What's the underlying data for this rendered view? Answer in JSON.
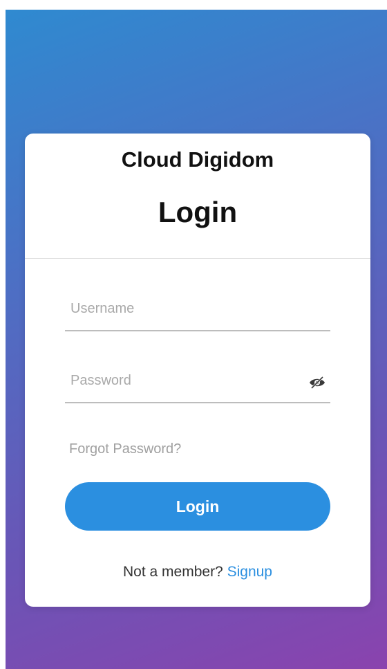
{
  "app": {
    "brand": "Cloud Digidom",
    "heading": "Login"
  },
  "form": {
    "username": {
      "value": "",
      "placeholder": "Username"
    },
    "password": {
      "value": "",
      "placeholder": "Password",
      "toggle_icon": "eye-slash-icon"
    },
    "forgot_label": "Forgot Password?",
    "login_label": "Login"
  },
  "footer": {
    "prompt": "Not a member?",
    "signup_label": "Signup"
  },
  "colors": {
    "accent": "#2b8fe0",
    "gradient_start": "#2f8ad0",
    "gradient_end": "#8a43ae",
    "card": "#ffffff"
  }
}
